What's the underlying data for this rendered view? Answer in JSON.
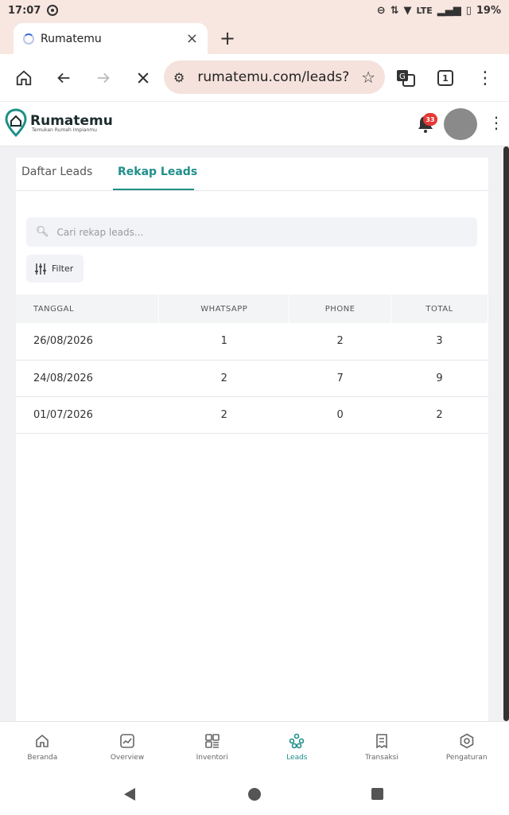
{
  "status_bar": {
    "time": "17:07",
    "network": "LTE",
    "battery": "19%"
  },
  "browser": {
    "tab_title": "Rumatemu",
    "tab_close": "×",
    "new_tab": "+",
    "url": "rumatemu.com/leads?",
    "tab_count": "1"
  },
  "app": {
    "brand": "Rumatemu",
    "tagline": "Temukan Rumah Impianmu",
    "notification_count": "33"
  },
  "tabs": [
    {
      "label": "Daftar Leads",
      "active": false
    },
    {
      "label": "Rekap Leads",
      "active": true
    }
  ],
  "search": {
    "placeholder": "Cari rekap leads..."
  },
  "filter": {
    "label": "Filter"
  },
  "table": {
    "headers": [
      "TANGGAL",
      "WHATSAPP",
      "PHONE",
      "TOTAL"
    ],
    "rows": [
      [
        "26/08/2026",
        "1",
        "2",
        "3"
      ],
      [
        "24/08/2026",
        "2",
        "7",
        "9"
      ],
      [
        "01/07/2026",
        "2",
        "0",
        "2"
      ]
    ]
  },
  "bottom_nav": [
    {
      "label": "Beranda",
      "icon": "home-icon",
      "active": false
    },
    {
      "label": "Overview",
      "icon": "chart-icon",
      "active": false
    },
    {
      "label": "Inventori",
      "icon": "grid-icon",
      "active": false
    },
    {
      "label": "Leads",
      "icon": "users-icon",
      "active": true
    },
    {
      "label": "Transaksi",
      "icon": "receipt-icon",
      "active": false
    },
    {
      "label": "Pengaturan",
      "icon": "settings-icon",
      "active": false
    }
  ],
  "colors": {
    "accent": "#1f8f8a",
    "chrome": "#f8e6e0",
    "badge": "#e53935"
  }
}
